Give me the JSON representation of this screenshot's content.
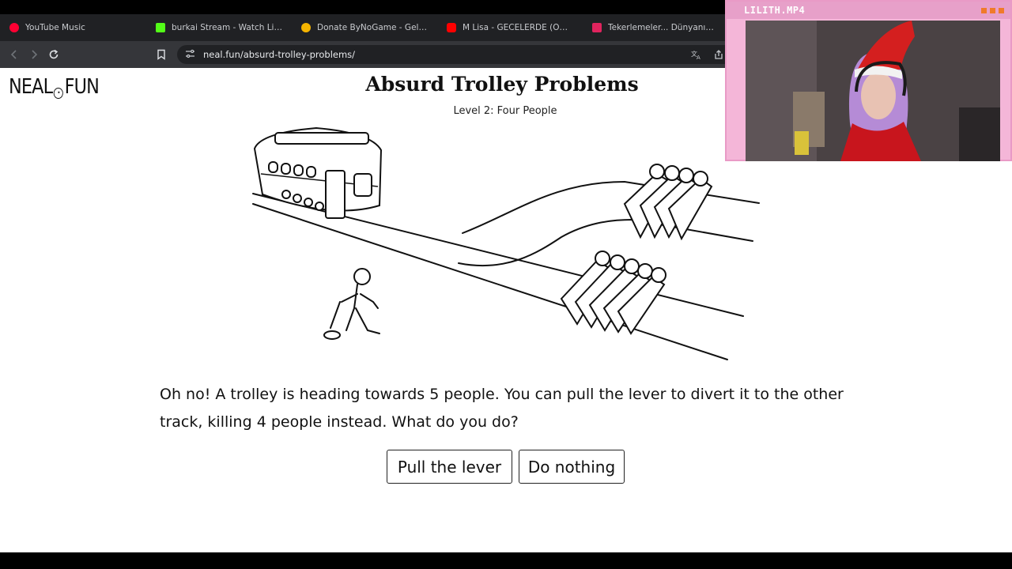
{
  "browser": {
    "tabs": [
      {
        "title": "YouTube Music",
        "color": "#ff0033"
      },
      {
        "title": "burkai Stream - Watch Live on K",
        "color": "#53fc18"
      },
      {
        "title": "Donate ByNoGame - Gelen/Gid",
        "color": "#f5b400"
      },
      {
        "title": "M Lisa - GECELERDE (Official Lyr",
        "color": "#ff0000"
      },
      {
        "title": "Tekerlemeler... Dünyanın En Zor",
        "color": "#e0245e"
      }
    ],
    "url": "neal.fun/absurd-trolley-problems/"
  },
  "site": {
    "logo_left": "NEAL",
    "logo_right": "FUN",
    "title": "Absurd Trolley Problems",
    "subtitle": "Level 2: Four People"
  },
  "question": "Oh no! A trolley is heading towards 5 people. You can pull the lever to divert it to the other track, killing 4 people instead. What do you do?",
  "buttons": {
    "pull": "Pull the lever",
    "nothing": "Do nothing"
  },
  "overlay": {
    "title": "LILITH.MP4"
  },
  "icons": {
    "back": "back-arrow-icon",
    "forward": "forward-arrow-icon",
    "reload": "reload-icon",
    "bookmark": "bookmark-icon",
    "site_info": "site-info-icon",
    "translate": "translate-icon",
    "share": "share-icon"
  }
}
